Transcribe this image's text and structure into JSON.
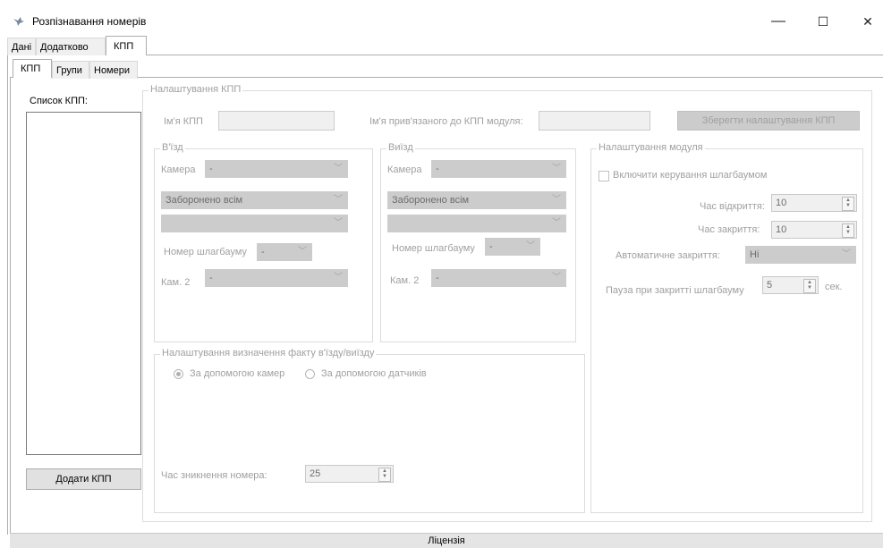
{
  "window": {
    "title": "Розпізнавання номерів",
    "minimize": "—",
    "maximize": "☐",
    "close": "✕"
  },
  "outer_tabs": [
    "Дані",
    "Додатково",
    "КПП"
  ],
  "inner_tabs": [
    "КПП",
    "Групи",
    "Номери"
  ],
  "left_panel": {
    "list_label": "Список КПП:",
    "add_button": "Додати КПП"
  },
  "settings": {
    "group_title": "Налаштування КПП",
    "name_label": "Ім'я КПП",
    "name_value": "",
    "module_label": "Ім'я прив'язаного до КПП модуля:",
    "module_value": "",
    "save_button": "Зберегти налаштування КПП"
  },
  "entry": {
    "title": "В'їзд",
    "camera_label": "Камера",
    "camera_value": "-",
    "access_value": "Заборонено всім",
    "extra_value": "",
    "barrier_label": "Номер шлагбауму",
    "barrier_value": "-",
    "cam2_label": "Кам. 2",
    "cam2_value": "-"
  },
  "exit": {
    "title": "Виїзд",
    "camera_label": "Камера",
    "camera_value": "-",
    "access_value": "Заборонено всім",
    "extra_value": "",
    "barrier_label": "Номер шлагбауму",
    "barrier_value": "-",
    "cam2_label": "Кам. 2",
    "cam2_value": "-"
  },
  "module": {
    "title": "Налаштування модуля",
    "barrier_control_label": "Включити керування шлагбаумом",
    "open_time_label": "Час відкриття:",
    "open_time_value": "10",
    "close_time_label": "Час закриття:",
    "close_time_value": "10",
    "auto_close_label": "Автоматичне закриття:",
    "auto_close_value": "Ні",
    "pause_label": "Пауза при закритті шлагбауму",
    "pause_value": "5",
    "pause_unit": "сек."
  },
  "detection": {
    "title": "Налаштування визначення факту в'їзду/виїзду",
    "option_cameras": "За допомогою камер",
    "option_sensors": "За допомогою датчиків",
    "selected": "За допомогою камер",
    "timeout_label": "Час зникнення номера:",
    "timeout_value": "25"
  },
  "footer": {
    "license_button": "Ліцензія"
  },
  "icons": {
    "app": "bird-icon",
    "chevron": "chevron-down-icon"
  }
}
